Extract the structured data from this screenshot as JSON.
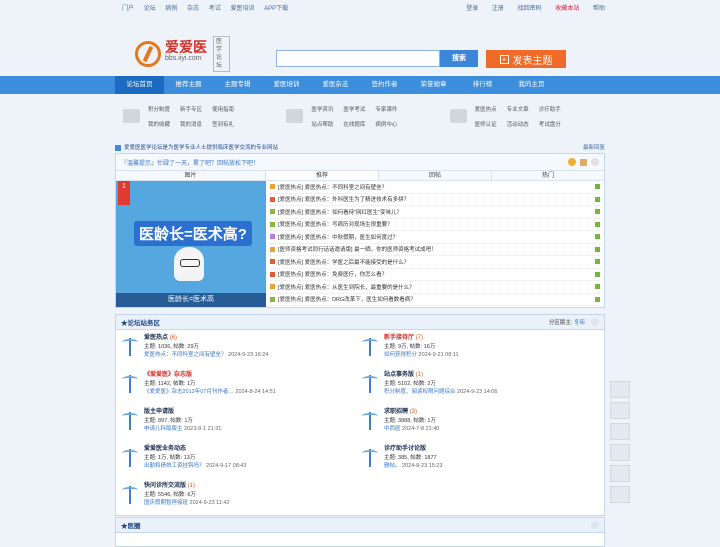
{
  "topbar": {
    "left": [
      "门户",
      "论坛",
      "病例",
      "杂志",
      "考试",
      "爱医培训",
      "APP下载"
    ],
    "right": [
      "登录",
      "注册",
      "找回密码",
      "收藏本站",
      "帮助"
    ]
  },
  "logo": {
    "cn": "爱爱医",
    "en": "bbs.iiyi.com",
    "sub": "医学论坛"
  },
  "search": {
    "placeholder": "",
    "button": "搜索"
  },
  "post_button": "发表主题",
  "nav": [
    "论坛首页",
    "推荐主题",
    "主题专辑",
    "爱医培训",
    "爱医杂志",
    "签约作者",
    "荣誉勋章",
    "排行榜",
    "我的主页"
  ],
  "quick": [
    {
      "links": [
        "积分制度",
        "新手专区",
        "使用指南",
        "我的收藏",
        "我的消息",
        "签到有礼"
      ]
    },
    {
      "links": [
        "医学资讯",
        "医学考试",
        "专家课件",
        "站点帮助",
        "在线题库",
        "病例中心"
      ]
    },
    {
      "links": [
        "爱医热点",
        "专业文章",
        "诊疗助手",
        "医师认证",
        "活动动态",
        "考试盘分"
      ]
    }
  ],
  "notice": {
    "text": "爱爱医医学论坛是为医学专业人士提供临床医学交流的专业网站",
    "right": "最新回复"
  },
  "hot": {
    "tip": "『温馨提示』忙碌了一天，累了吧？回帖放松下吧！",
    "tabs": [
      "图片",
      "推荐",
      "回帖",
      "热门"
    ],
    "banner": {
      "badge": "1",
      "headline": "医龄长=医术高?",
      "caption": "医龄长=医术高"
    },
    "items": [
      {
        "text": "[爱医热点] 爱医热点：不同科室之间有壁垒？",
        "color": "#e8a23a"
      },
      {
        "text": "[爱医热点] 爱医热点：外科医生为了精进技术有多拼？",
        "color": "#e45b3a"
      },
      {
        "text": "[爱医热点] 爱医热点：如何看待\"网红医生\"变味儿？",
        "color": "#8ab83c"
      },
      {
        "text": "[爱医热点] 爱医热点：写病历对现场生很重要？",
        "color": "#8ab83c"
      },
      {
        "text": "[爱医热点] 爱医热点：中秋假期，医生如何度过？",
        "color": "#b67ed8"
      },
      {
        "text": "[医师资格考试同行话话邀请版] 最一晒，你的医师资格考试成吧！",
        "color": "#e8a23a"
      },
      {
        "text": "[爱医热点] 爱医热点：学医之后最不能接受的是什么？",
        "color": "#e45b3a"
      },
      {
        "text": "[爱医热点] 爱医热点：免费医疗，你怎么看？",
        "color": "#e45b3a"
      },
      {
        "text": "[爱医热点] 爱医热点：从医生到院长，最重要的是什么？",
        "color": "#e8a23a"
      },
      {
        "text": "[爱医热点] 爱医热点：DRG改革下，医生如何看数看病？",
        "color": "#8ab83c"
      }
    ]
  },
  "forum": {
    "title": "★论坛站务区",
    "moderator_label": "分区版主:",
    "moderator": "冬街",
    "boards": [
      {
        "name": "爱医热点",
        "count": "(6)",
        "stats": "主题: 1036, 帖数: 29万",
        "last": "爱医热点：不同科室之间有壁垒？",
        "time": "2024-9-23 16:24"
      },
      {
        "name": "新手接待厅",
        "count": "(7)",
        "stats": "主题: 9万, 帖数: 16万",
        "last": "如何获得积分",
        "time": "2024-9-21 08:11",
        "red": true
      },
      {
        "name": "《爱爱医》杂志版",
        "count": "",
        "stats": "主题: 1142, 帖数: 1万",
        "last": "《爱爱医》杂志2012年07月刊作者…",
        "time": "2024-8-24 14:51",
        "red": true
      },
      {
        "name": "站点事务版",
        "count": "(1)",
        "stats": "主题: 5102, 帖数: 2万",
        "last": "积分制度、阅读权限问题综合",
        "time": "2024-9-23 14:06"
      },
      {
        "name": "版主申请版",
        "count": "",
        "stats": "主题: 897, 帖数: 1万",
        "last": "申请儿科版版主",
        "time": "2023-8-1 21:31"
      },
      {
        "name": "求职招聘",
        "count": "(3)",
        "stats": "主题: 3888, 帖数: 1万",
        "last": "中西医",
        "time": "2024-7-8 21:40"
      },
      {
        "name": "爱爱医业务动态",
        "count": "",
        "stats": "主题: 1万, 帖数: 13万",
        "last": "出勤和绩效工资挂钩吗？",
        "time": "2024-9-17 08:43"
      },
      {
        "name": "诊疗助手讨论版",
        "count": "",
        "stats": "主题: 385, 帖数: 1877",
        "last": "删帖。",
        "time": "2024-8-23 15:23"
      },
      {
        "name": "快问诊所交流版",
        "count": "(1)",
        "stats": "主题: 5546, 帖数: 6万",
        "last": "国庆假期暂停接班",
        "time": "2024-9-23 11:42"
      }
    ]
  },
  "forum2": {
    "title": "★医圈"
  },
  "colors": {
    "nav": "#3c8ddb",
    "accent": "#f06a28"
  },
  "sidebar_icons": [
    "chat-icon",
    "feedback-icon",
    "user-icon",
    "share-icon",
    "wechat-icon",
    "weibo-icon"
  ]
}
